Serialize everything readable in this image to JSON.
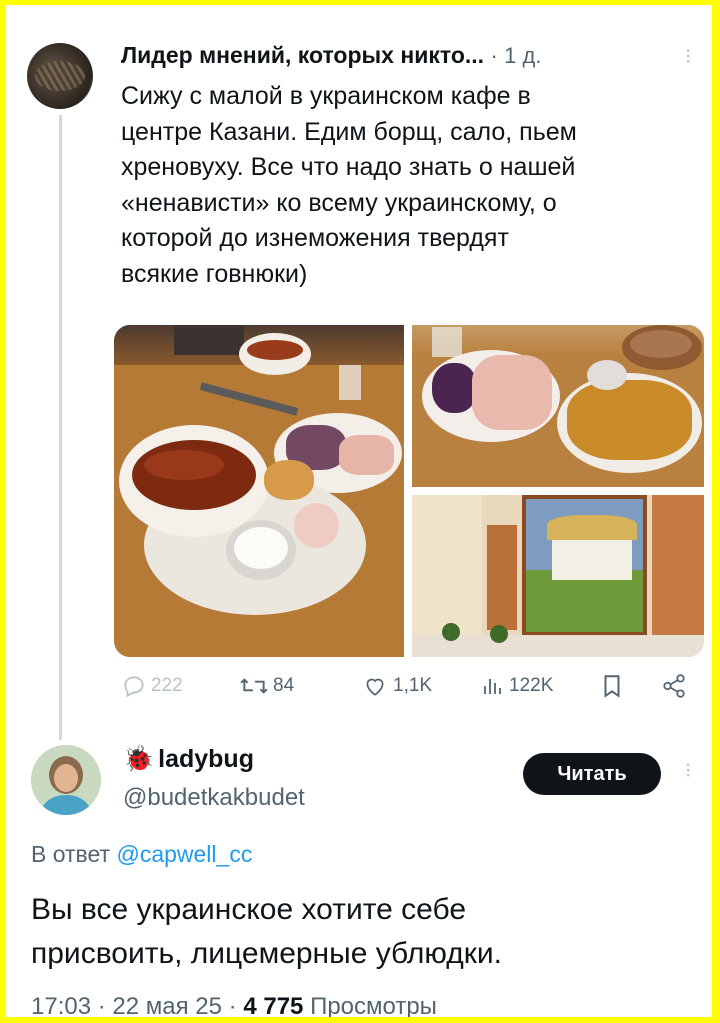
{
  "tweet": {
    "author_name": "Лидер мнений, которых никто...",
    "separator": "·",
    "time": "1 д.",
    "text": "Сижу с малой в украинском кафе в\nцентре Казани. Едим борщ, сало, пьем\nхреновуху. Все что надо знать о нашей\n«ненависти» ко всему украинскому, о\nкоторой до изнеможения твердят\nвсякие говнюки)",
    "media_description_icons": [
      "food-photo",
      "food-photo",
      "interior-photo"
    ],
    "actions": {
      "replies": "222",
      "retweets": "84",
      "likes": "1,1K",
      "views": "122K"
    }
  },
  "reply": {
    "display_name": "ladybug",
    "name_emoji": "🐞",
    "handle": "@budetkakbudet",
    "follow_label": "Читать",
    "reply_to_prefix": "В ответ",
    "reply_to_handle": "@capwell_cc",
    "text": "Вы все украинское хотите себе\nприсвоить, лицемерные ублюдки.",
    "time": "17:03",
    "date": "22 мая 25",
    "views_count": "4 775",
    "views_label": "Просмотры"
  },
  "colors": {
    "frame": "#ffff00",
    "text": "#0f1419",
    "secondary": "#536471",
    "link": "#1d9bf0",
    "button": "#0f1419"
  }
}
